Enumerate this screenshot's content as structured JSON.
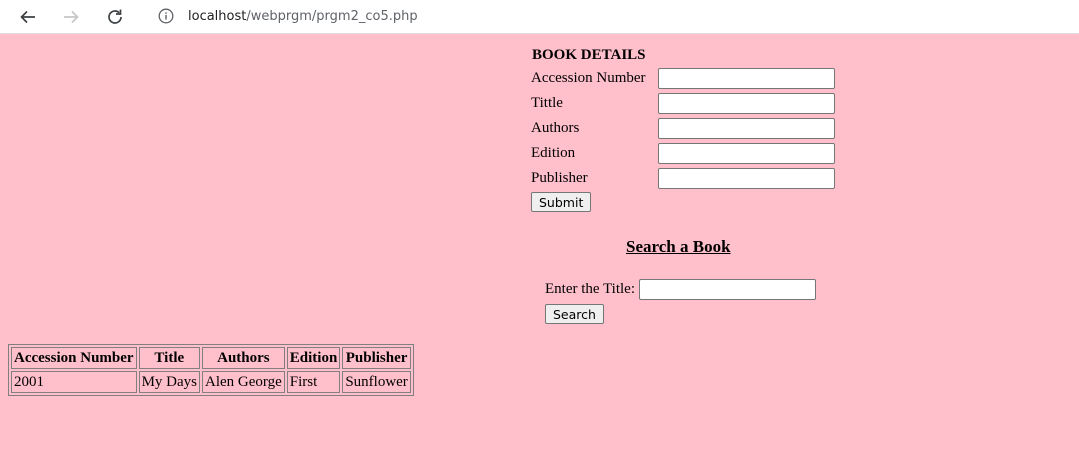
{
  "browser": {
    "url_host": "localhost",
    "url_path": "/webprgm/prgm2_co5.php",
    "icons": {
      "back": "arrow-left-icon",
      "forward": "arrow-right-icon",
      "reload": "reload-icon",
      "site_info": "info-icon"
    }
  },
  "form": {
    "heading": "BOOK DETAILS",
    "fields": [
      {
        "label": "Accession Number",
        "value": ""
      },
      {
        "label": "Tittle",
        "value": ""
      },
      {
        "label": "Authors",
        "value": ""
      },
      {
        "label": "Edition",
        "value": ""
      },
      {
        "label": "Publisher",
        "value": ""
      }
    ],
    "submit_label": "Submit"
  },
  "search": {
    "title": "Search a Book",
    "label": "Enter the Title:",
    "value": "",
    "button_label": "Search"
  },
  "table": {
    "headers": [
      "Accession Number",
      "Title",
      "Authors",
      "Edition",
      "Publisher"
    ],
    "rows": [
      [
        "2001",
        "My Days",
        "Alen George",
        "First",
        "Sunflower"
      ]
    ]
  },
  "colors": {
    "page_background": "#ffc0cb"
  }
}
